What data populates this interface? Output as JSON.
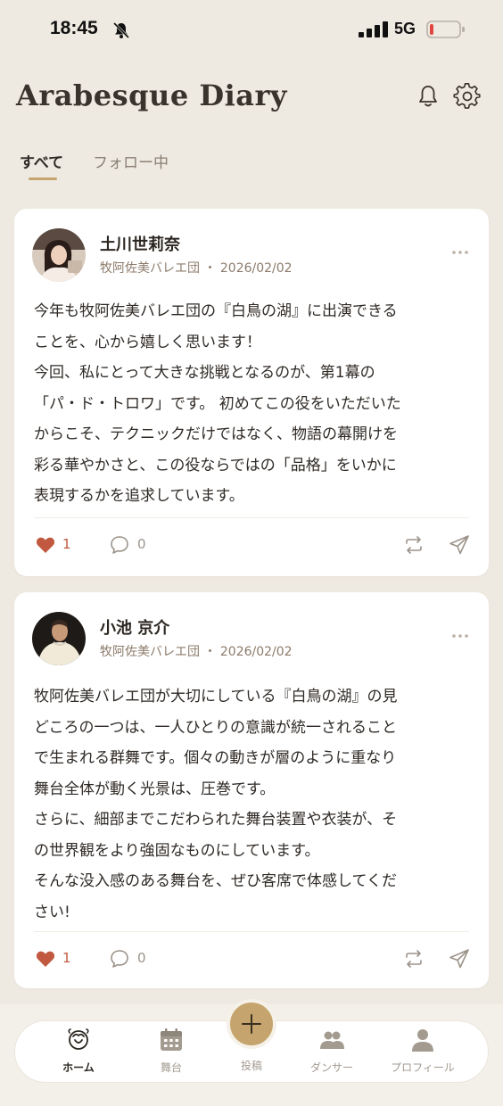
{
  "status_bar": {
    "time": "18:45",
    "network": "5G"
  },
  "header": {
    "title": "Arabesque Diary"
  },
  "tabs": [
    {
      "label": "すべて",
      "active": true
    },
    {
      "label": "フォロー中",
      "active": false
    }
  ],
  "posts": [
    {
      "author": "土川世莉奈",
      "meta": "牧阿佐美バレエ団 ・ 2026/02/02",
      "text": "今年も牧阿佐美バレエ団の『白鳥の湖』に出演できる\nことを、心から嬉しく思います！\n今回、私にとって大きな挑戦となるのが、第1幕の\n「パ・ド・トロワ」です。 初めてこの役をいただいた\nからこそ、テクニックだけではなく、物語の幕開けを\n彩る華やかさと、この役ならではの「品格」をいかに\n表現するかを追求しています。",
      "likes": "1",
      "comments": "0"
    },
    {
      "author": "小池 京介",
      "meta": "牧阿佐美バレエ団 ・ 2026/02/02",
      "text": "牧阿佐美バレエ団が大切にしている『白鳥の湖』の見\nどころの一つは、一人ひとりの意識が統一されること\nで生まれる群舞です。個々の動きが層のように重なり\n舞台全体が動く光景は、圧巻です。\nさらに、細部までこだわられた舞台装置や衣装が、そ\nの世界観をより強固なものにしています。\nそんな没入感のある舞台を、ぜひ客席で体感してくだ\nさい!",
      "likes": "1",
      "comments": "0"
    }
  ],
  "bottom_nav": {
    "home": "ホーム",
    "stage": "舞台",
    "post": "投稿",
    "dancer": "ダンサー",
    "profile": "プロフィール"
  },
  "colors": {
    "background": "#efeae1",
    "accent_gold": "#c5a46d",
    "like_red": "#c0593f",
    "card": "#ffffff"
  },
  "icons": [
    "bell-off-icon",
    "signal-icon",
    "battery-icon",
    "bell-icon",
    "gear-icon",
    "more-dots-icon",
    "heart-icon",
    "comment-icon",
    "repost-icon",
    "send-icon",
    "home-logo-icon",
    "calendar-icon",
    "plus-icon",
    "people-icon",
    "person-icon"
  ]
}
